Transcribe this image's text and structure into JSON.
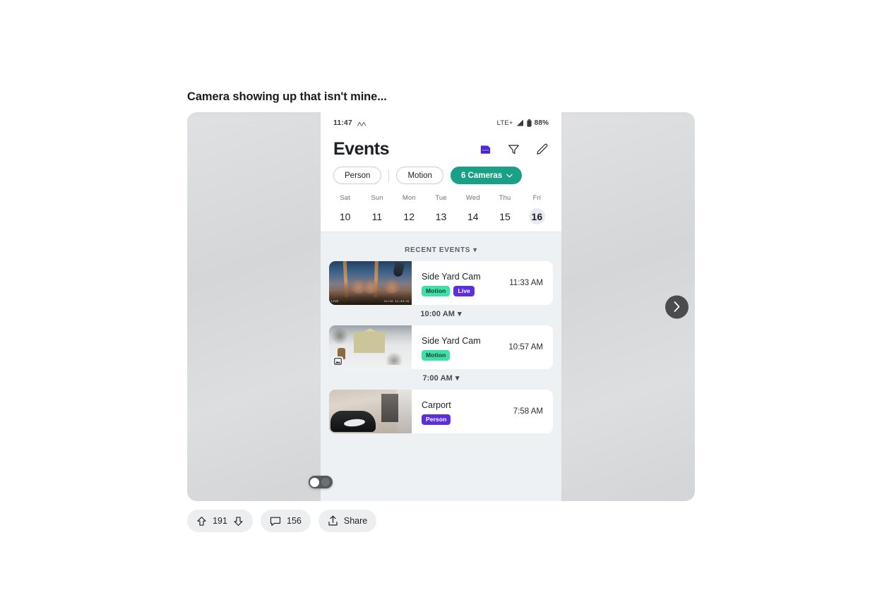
{
  "post": {
    "title": "Camera showing up that isn't mine..."
  },
  "phone": {
    "status_bar": {
      "time": "11:47",
      "network": "LTE+",
      "battery_percent": "88%",
      "wifi_icon": "signal-up-icon",
      "signal_icon": "cell-signal-icon",
      "battery_icon": "battery-icon"
    },
    "header": {
      "title": "Events",
      "icons": [
        {
          "name": "storage-card-icon",
          "label": "Storage"
        },
        {
          "name": "filter-funnel-icon",
          "label": "Filter"
        },
        {
          "name": "edit-pencil-icon",
          "label": "Edit"
        }
      ]
    },
    "filters": {
      "chips": [
        {
          "label": "Person",
          "active": false
        },
        {
          "label": "Motion",
          "active": false
        }
      ],
      "camera_selector": {
        "label": "6 Cameras",
        "active": true,
        "accent": "#19a086",
        "chevron": "chevron-down-icon"
      }
    },
    "date_strip": {
      "days": [
        {
          "dow": "Sat",
          "num": "10",
          "selected": false
        },
        {
          "dow": "Sun",
          "num": "11",
          "selected": false
        },
        {
          "dow": "Mon",
          "num": "12",
          "selected": false
        },
        {
          "dow": "Tue",
          "num": "13",
          "selected": false
        },
        {
          "dow": "Wed",
          "num": "14",
          "selected": false
        },
        {
          "dow": "Thu",
          "num": "15",
          "selected": false
        },
        {
          "dow": "Fri",
          "num": "16",
          "selected": true
        }
      ]
    },
    "sections": [
      {
        "header": "RECENT EVENTS",
        "caret": "▾",
        "events": [
          {
            "camera": "Side Yard Cam",
            "time": "11:33 AM",
            "badges": [
              {
                "label": "Motion",
                "color": "#3fe0a8",
                "text_color": "#143c2e"
              },
              {
                "label": "Live",
                "color": "#5b2fdb",
                "text_color": "#ffffff"
              }
            ],
            "thumb_stamp_left": "LIVE",
            "thumb_stamp_right": "11/16 11:33:41",
            "has_image_badge": false
          }
        ]
      },
      {
        "header": "10:00 AM",
        "caret": "▾",
        "events": [
          {
            "camera": "Side Yard Cam",
            "time": "10:57 AM",
            "badges": [
              {
                "label": "Motion",
                "color": "#3fe0a8",
                "text_color": "#143c2e"
              }
            ],
            "thumb_stamp_left": "",
            "thumb_stamp_right": "",
            "has_image_badge": true
          }
        ]
      },
      {
        "header": "7:00 AM",
        "caret": "▾",
        "events": [
          {
            "camera": "Carport",
            "time": "7:58 AM",
            "badges": [
              {
                "label": "Person",
                "color": "#5b2fdb",
                "text_color": "#ffffff"
              }
            ],
            "thumb_stamp_left": "",
            "thumb_stamp_right": "",
            "has_image_badge": false
          }
        ]
      }
    ],
    "next_button": {
      "name": "next-image-icon",
      "label": "Next"
    }
  },
  "actions": {
    "upvote_icon": "upvote-arrow-icon",
    "score": "191",
    "downvote_icon": "downvote-arrow-icon",
    "comment_icon": "comment-bubble-icon",
    "comment_count": "156",
    "share_icon": "share-icon",
    "share_label": "Share"
  }
}
